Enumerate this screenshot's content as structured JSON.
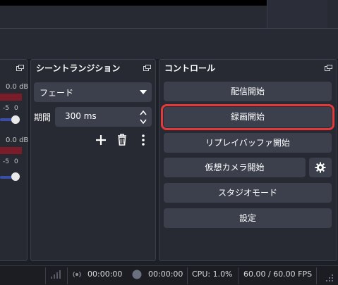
{
  "mixer": {
    "channel1_db": "0.0 dB",
    "channel2_db": "0.0 dB",
    "scale1": "-5",
    "scale1b": "0",
    "scale2": "-5",
    "scale2b": "0"
  },
  "transitions": {
    "title": "シーントランジション",
    "selected_transition": "フェード",
    "duration_label": "期間",
    "duration_value": "300 ms"
  },
  "controls": {
    "title": "コントロール",
    "buttons": [
      "配信開始",
      "録画開始",
      "リプレイバッファ開始",
      "仮想カメラ開始",
      "スタジオモード",
      "設定"
    ]
  },
  "status": {
    "stream_time": "00:00:00",
    "record_time": "00:00:00",
    "cpu": "CPU: 1.0%",
    "fps": "60.00 / 60.00 FPS"
  },
  "colors": {
    "highlight": "#e23a3a",
    "accent": "#3b4ea7"
  }
}
